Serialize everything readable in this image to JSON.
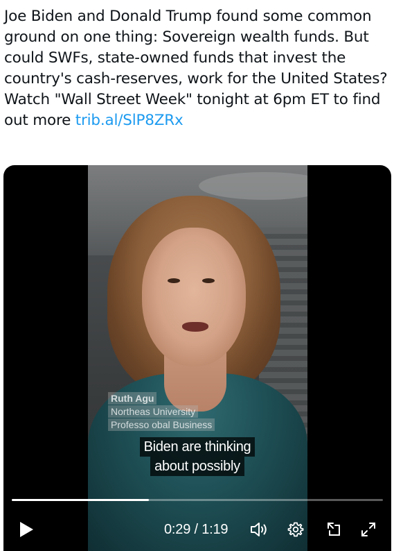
{
  "tweet": {
    "text": "Joe Biden and Donald Trump found some common ground on one thing: Sovereign wealth funds. But could SWFs, state-owned funds that invest the country's cash-reserves, work for the United States? Watch \"Wall Street Week\" tonight at 6pm ET to find out more ",
    "link_text": "trib.al/SlP8ZRx"
  },
  "video": {
    "lower_third": {
      "name": "Ruth Agu",
      "line2": "Northeas      University",
      "line3": "Professo      obal Business"
    },
    "captions": [
      "Biden are thinking",
      "about possibly"
    ],
    "progress": 0.37,
    "time_current": "0:29",
    "time_separator": "/",
    "time_total": "1:19"
  },
  "icons": {
    "play": "play-icon",
    "volume": "volume-icon",
    "settings": "gear-icon",
    "minimize": "pip-icon",
    "fullscreen": "fullscreen-icon"
  },
  "colors": {
    "link": "#1d9bf0",
    "text": "#0f1419"
  }
}
